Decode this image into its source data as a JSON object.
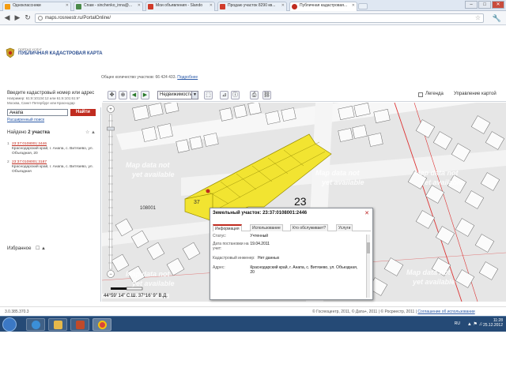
{
  "browser": {
    "tabs": [
      {
        "label": "Одноклассники",
        "color": "#f39c12"
      },
      {
        "label": "Спам - sinchenko_inna@...",
        "color": "#4a8a4a"
      },
      {
        "label": "Мои объявления - Slando",
        "color": "#d03b2a"
      },
      {
        "label": "Продаю участок 8290 кв...",
        "color": "#d03b2a"
      },
      {
        "label": "Публичная кадастровая...",
        "color": "#c02b1f"
      }
    ],
    "url": "maps.rosreestr.ru/PortalOnline/",
    "window_buttons": [
      "–",
      "□",
      "✕"
    ]
  },
  "header": {
    "portal_small": "ПОРТАЛ УСЛУГ",
    "portal_title": "ПУБЛИЧНАЯ КАДАСТРОВАЯ КАРТА",
    "objects_text": "Общее количество участков: 66 424 433.",
    "objects_link": "Подробнее"
  },
  "search": {
    "label": "Введите кадастровый номер или адрес",
    "hints": [
      "Например: 61:8:10134:12 или 61:6:101:61:6*",
      "Москва, Санкт-Петербург или Краснодар",
      ""
    ],
    "value": "Анапа",
    "button": "Найти",
    "advanced_link": "Расширенный поиск"
  },
  "results": {
    "title_prefix": "Найдено",
    "title_count": "2 участка",
    "items": [
      {
        "num": "1",
        "cad": "23:37:0108001:2446",
        "addr": "Краснодарский край, г. Анапа, с. Витязево, ул. Объездная, 20"
      },
      {
        "num": "2",
        "cad": "23:37:0108001:3187",
        "addr": "Краснодарский край, г. Анапа, с. Витязево, ул. Объездная"
      }
    ],
    "favorites": "Избранное"
  },
  "toolbar": {
    "layer": "Недвижимость",
    "legend": "Легенда",
    "map_control": "Управление картой"
  },
  "map": {
    "watermark_line1": "Map data not",
    "watermark_line2": "yet available",
    "big_label": "23",
    "quarter_label": "108001",
    "parcel_label": "37",
    "coords": "44°59' 14\" С.Ш. 37°16' 9\" В.Д.",
    "scale_labels": [
      "0",
      "20",
      "40м"
    ]
  },
  "popup": {
    "title": "Земельный участок: 23:37:0108001:2446",
    "tabs": [
      "Информация",
      "Использование",
      "Кто обслуживает?",
      "Услуги"
    ],
    "rows": [
      {
        "label": "Статус:",
        "value": "Учтенный"
      },
      {
        "label": "Дата постановки на учет:",
        "value": "19.04.2011"
      },
      {
        "label": "Кадастровый инженер:",
        "value": "Нет данных"
      },
      {
        "label": "Адрес:",
        "value": "Краснодарский край, г. Анапа, с. Витязево, ул. Объездная, 20"
      }
    ]
  },
  "footer": {
    "version": "3.0.385.370.3",
    "copyright": "© Госгеоцентр, 2011, © Дата+, 2011 | © Росреестр, 2011 |",
    "agreement_link": "Соглашение об использовании"
  },
  "taskbar": {
    "lang": "RU",
    "time": "11:28",
    "date": "25.12.2012"
  },
  "colors": {
    "brand_red": "#c02b1f",
    "parcel_yellow": "#f2e431",
    "map_bg": "#e8e8e8"
  }
}
